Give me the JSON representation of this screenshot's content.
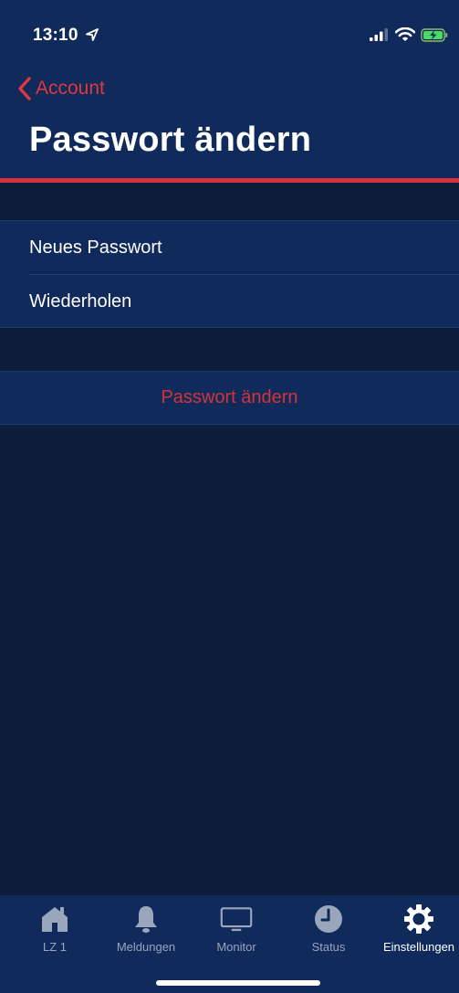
{
  "status_bar": {
    "time": "13:10"
  },
  "nav": {
    "back_label": "Account",
    "title": "Passwort ändern"
  },
  "form": {
    "new_password_placeholder": "Neues Passwort",
    "repeat_placeholder": "Wiederholen",
    "submit_label": "Passwort ändern"
  },
  "tabs": [
    {
      "label": "LZ 1",
      "icon": "house-icon",
      "active": false
    },
    {
      "label": "Meldungen",
      "icon": "bell-icon",
      "active": false
    },
    {
      "label": "Monitor",
      "icon": "monitor-icon",
      "active": false
    },
    {
      "label": "Status",
      "icon": "clock-icon",
      "active": false
    },
    {
      "label": "Einstellungen",
      "icon": "gear-icon",
      "active": true
    }
  ],
  "colors": {
    "background": "#0d1e3d",
    "header": "#0f2a5b",
    "accent_red": "#d6333a",
    "tab_inactive": "#9aa6bb",
    "tab_active": "#ffffff"
  }
}
